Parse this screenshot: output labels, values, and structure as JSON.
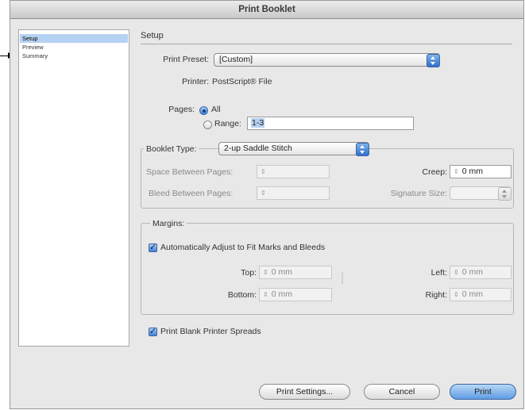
{
  "window": {
    "title": "Print Booklet"
  },
  "sidebar": {
    "items": [
      {
        "label": "Setup",
        "selected": true
      },
      {
        "label": "Preview",
        "selected": false
      },
      {
        "label": "Summary",
        "selected": false
      }
    ]
  },
  "setup": {
    "section_title": "Setup",
    "print_preset": {
      "label": "Print Preset:",
      "value": "[Custom]"
    },
    "printer": {
      "label": "Printer:",
      "value": "PostScript® File"
    },
    "pages": {
      "label": "Pages:",
      "all_label": "All",
      "range_label": "Range:",
      "range_value": "1-3",
      "selected": "All"
    },
    "booklet_type": {
      "label": "Booklet Type:",
      "value": "2-up Saddle Stitch"
    },
    "space_between_pages": {
      "label": "Space Between Pages:",
      "value": ""
    },
    "bleed_between_pages": {
      "label": "Bleed Between Pages:",
      "value": ""
    },
    "creep": {
      "label": "Creep:",
      "value": "0 mm"
    },
    "signature_size": {
      "label": "Signature Size:",
      "value": ""
    }
  },
  "margins": {
    "title": "Margins:",
    "auto_adjust": {
      "label": "Automatically Adjust to Fit Marks and Bleeds",
      "checked": true
    },
    "top": {
      "label": "Top:",
      "value": "0 mm"
    },
    "bottom": {
      "label": "Bottom:",
      "value": "0 mm"
    },
    "left": {
      "label": "Left:",
      "value": "0 mm"
    },
    "right": {
      "label": "Right:",
      "value": "0 mm"
    }
  },
  "print_blank": {
    "label": "Print Blank Printer Spreads",
    "checked": true
  },
  "buttons": {
    "print_settings": "Print Settings...",
    "cancel": "Cancel",
    "print": "Print"
  },
  "colors": {
    "accent": "#3f82d7",
    "selection": "#b5d2f2",
    "window_bg": "#e8e8e8"
  }
}
